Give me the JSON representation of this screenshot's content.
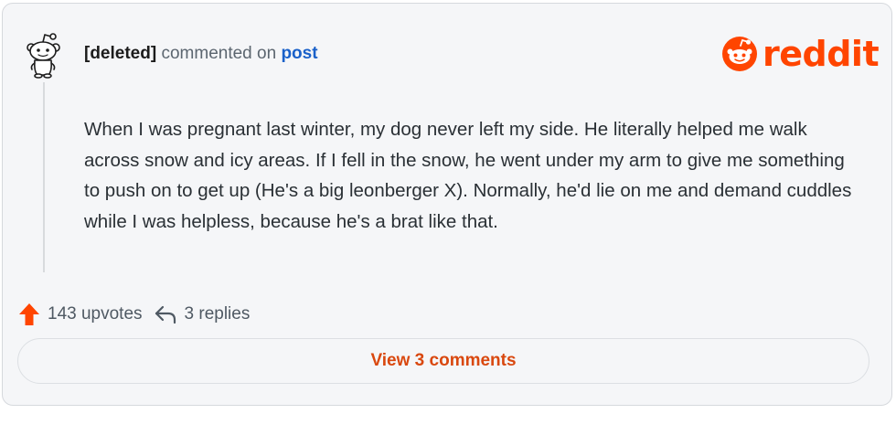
{
  "comment": {
    "author": "[deleted]",
    "action_text": "commented on",
    "post_link_label": "post",
    "body": "When I was pregnant last winter, my dog never left my side. He literally helped me walk across snow and icy areas. If I fell in the snow, he went under my arm to give me something to push on to get up (He's a big leonberger X). Normally, he'd lie on me and demand cuddles while I was helpless, because he's a brat like that.",
    "upvotes_label": "143 upvotes",
    "replies_label": "3 replies"
  },
  "footer": {
    "view_comments_label": "View 3 comments"
  },
  "branding": {
    "wordmark": "reddit",
    "brand_color": "#ff4500"
  },
  "icons": {
    "avatar": "snoo-avatar-icon",
    "upvote": "upvote-arrow-icon",
    "reply": "reply-arrow-icon",
    "logo": "reddit-snoo-icon"
  }
}
